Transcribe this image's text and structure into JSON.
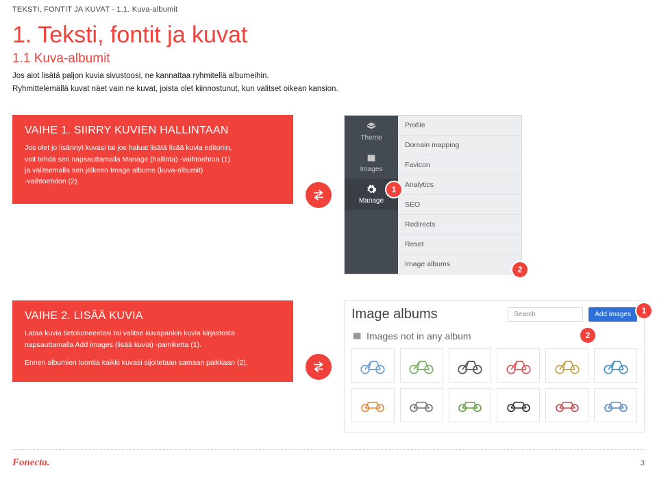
{
  "breadcrumb": "TEKSTI, FONTIT JA KUVAT  -  1.1. Kuva-albumit",
  "heading": "1. Teksti, fontit ja kuvat",
  "subheading": "1.1 Kuva-albumit",
  "intro": {
    "line1": "Jos aiot lisätä paljon kuvia sivustoosi, ne kannattaa ryhmitellä albumeihin.",
    "line2": "Ryhmittelemällä kuvat näet vain ne kuvat, joista olet kiinnostunut, kun valitset oikean kansion."
  },
  "step1": {
    "title": "VAIHE 1. SIIRRY KUVIEN HALLINTAAN",
    "body_l1": "Jos olet jo lisännyt kuvasi tai jos haluat lisätä lisää kuvia editoriin,",
    "body_l2": "voit tehdä sen napsauttamalla Manage (hallinta) -vaihtoehtoa (1)",
    "body_l3": "ja valitsemalla sen jälkeen Image albums (kuva-albumit)",
    "body_l4": "-vaihtoehdon (2).",
    "badge1": "1",
    "badge2": "2",
    "left_tabs": {
      "theme": "Theme",
      "images": "Images",
      "manage": "Manage"
    },
    "right_rows": [
      "Profile",
      "Domain mapping",
      "Favicon",
      "Analytics",
      "SEO",
      "Redirects",
      "Reset",
      "Image albums"
    ]
  },
  "step2": {
    "title": "VAIHE 2. LISÄÄ KUVIA",
    "body_l1": "Lataa kuvia tietokoneestasi tai valitse kuvapankin kuvia kirjastosta",
    "body_l2": "napsauttamalla Add images (lisää kuvia) -painiketta (1).",
    "body_l3": "Ennen albumien luontia kaikki kuvasi sijoitetaan samaan paikkaan (2).",
    "badge1": "1",
    "badge2": "2",
    "albums_title": "Image albums",
    "search_placeholder": "Search",
    "add_images": "Add images",
    "sub_title": "Images not in any album"
  },
  "footer": {
    "brand": "Fonecta",
    "pagenum": "3"
  }
}
